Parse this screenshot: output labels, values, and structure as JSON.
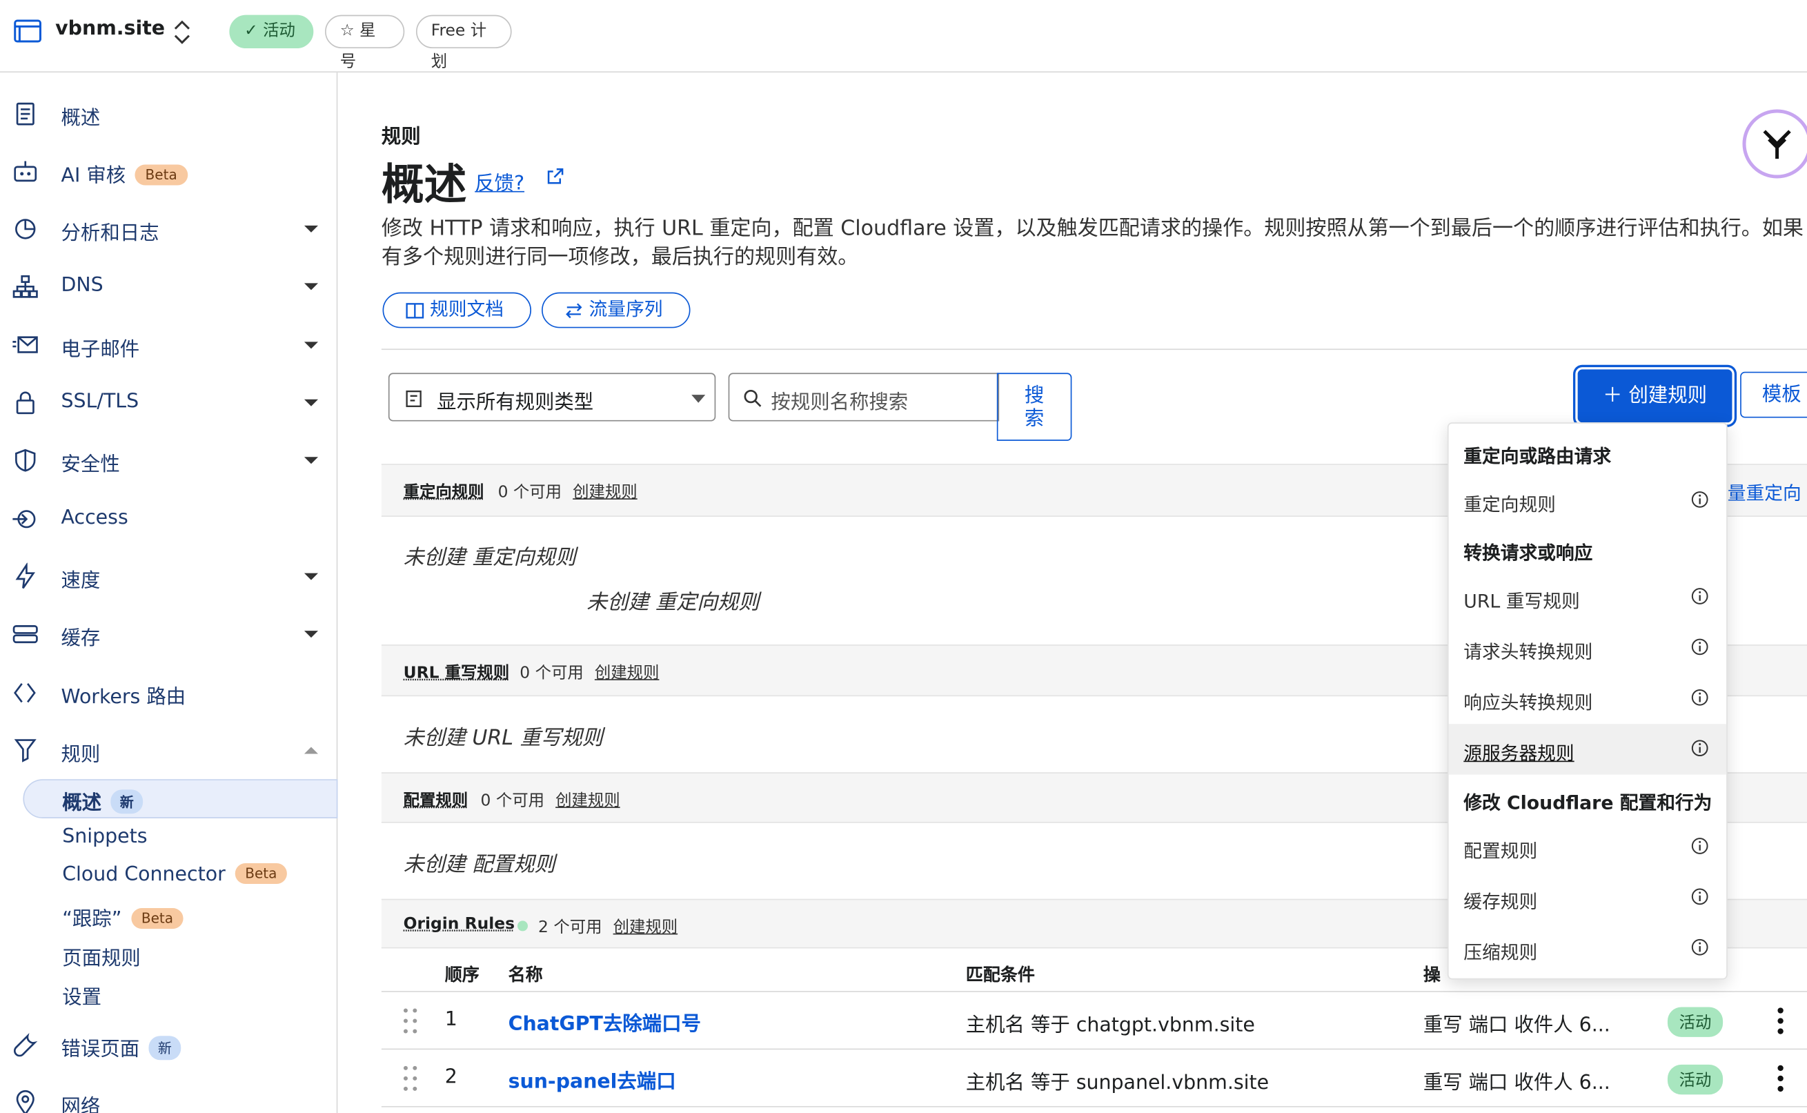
{
  "topbar": {
    "site_name": "vbnm.site",
    "status_pill": "活动",
    "star_pill": "星号",
    "plan_pill": "Free 计划"
  },
  "sidebar": {
    "items": [
      {
        "label": "概述",
        "icon": "document-icon"
      },
      {
        "label": "AI 审核",
        "icon": "robot-icon",
        "badge": "Beta"
      },
      {
        "label": "分析和日志",
        "icon": "chart-pie-icon"
      },
      {
        "label": "DNS",
        "icon": "network-icon"
      },
      {
        "label": "电子邮件",
        "icon": "mail-icon"
      },
      {
        "label": "SSL/TLS",
        "icon": "lock-icon"
      },
      {
        "label": "安全性",
        "icon": "shield-icon"
      },
      {
        "label": "Access",
        "icon": "access-icon"
      },
      {
        "label": "速度",
        "icon": "lightning-icon"
      },
      {
        "label": "缓存",
        "icon": "storage-icon"
      },
      {
        "label": "Workers 路由",
        "icon": "workers-icon"
      },
      {
        "label": "规则",
        "icon": "rules-icon"
      }
    ],
    "sub_items": {
      "overview": "概述",
      "overview_badge": "新",
      "snippets": "Snippets",
      "cloud_connector": "Cloud Connector",
      "cloud_connector_badge": "Beta",
      "trace": "“跟踪”",
      "trace_badge": "Beta",
      "page_rules": "页面规则",
      "settings": "设置"
    },
    "error_pages": {
      "label": "错误页面",
      "badge": "新"
    },
    "network": {
      "label": "网络"
    }
  },
  "main": {
    "breadcrumb": "规则",
    "title": "概述",
    "feedback": "反馈?",
    "description": "修改 HTTP 请求和响应，执行 URL 重定向，配置 Cloudflare 设置，以及触发匹配请求的操作。规则按照从第一个到最后一个的顺序进行评估和执行。如果有多个规则进行同一项修改，最后执行的规则有效。",
    "docs_button": "规则文档",
    "traffic_button": "流量序列",
    "filter_select": "显示所有规则类型",
    "search_placeholder": "按规则名称搜索",
    "search_button": "搜索",
    "create_button": "创建规则",
    "template_button": "模板",
    "behind_menu_link": "量重定向"
  },
  "sections": {
    "redirect": {
      "title": "重定向规则",
      "available": "0 个可用",
      "create": "创建规则",
      "empty": "未创建 重定向规则",
      "empty_ghost": "未创建 重定向规则"
    },
    "url_rewrite": {
      "title": "URL 重写规则",
      "available": "0 个可用",
      "create": "创建规则",
      "empty": "未创建 URL 重写规则"
    },
    "config": {
      "title": "配置规则",
      "available": "0 个可用",
      "create": "创建规则",
      "empty": "未创建 配置规则"
    },
    "origin": {
      "title": "Origin Rules",
      "available": "2 个可用",
      "create": "创建规则"
    }
  },
  "table": {
    "headers": {
      "order": "顺序",
      "name": "名称",
      "match": "匹配条件",
      "action": "操"
    },
    "rows": [
      {
        "order": "1",
        "name": "ChatGPT去除端口号",
        "match": "主机名 等于 chatgpt.vbnm.site",
        "action": "重写 端口 收件人 6...",
        "status": "活动"
      },
      {
        "order": "2",
        "name": "sun-panel去端口",
        "match": "主机名 等于 sunpanel.vbnm.site",
        "action": "重写 端口 收件人 6...",
        "status": "活动"
      }
    ]
  },
  "menu": {
    "group1": "重定向或路由请求",
    "redirect_rules": "重定向规则",
    "group2": "转换请求或响应",
    "url_rewrite_rules": "URL 重写规则",
    "request_header_rules": "请求头转换规则",
    "response_header_rules": "响应头转换规则",
    "origin_rules": "源服务器规则",
    "group3": "修改 Cloudflare 配置和行为",
    "config_rules": "配置规则",
    "cache_rules": "缓存规则",
    "compression_rules": "压缩规则"
  },
  "colors": {
    "accent": "#0b59d6",
    "active_green": "#a8e6bf",
    "beta_orange": "#f8c9a0",
    "nav_text": "#1e3a6e"
  }
}
